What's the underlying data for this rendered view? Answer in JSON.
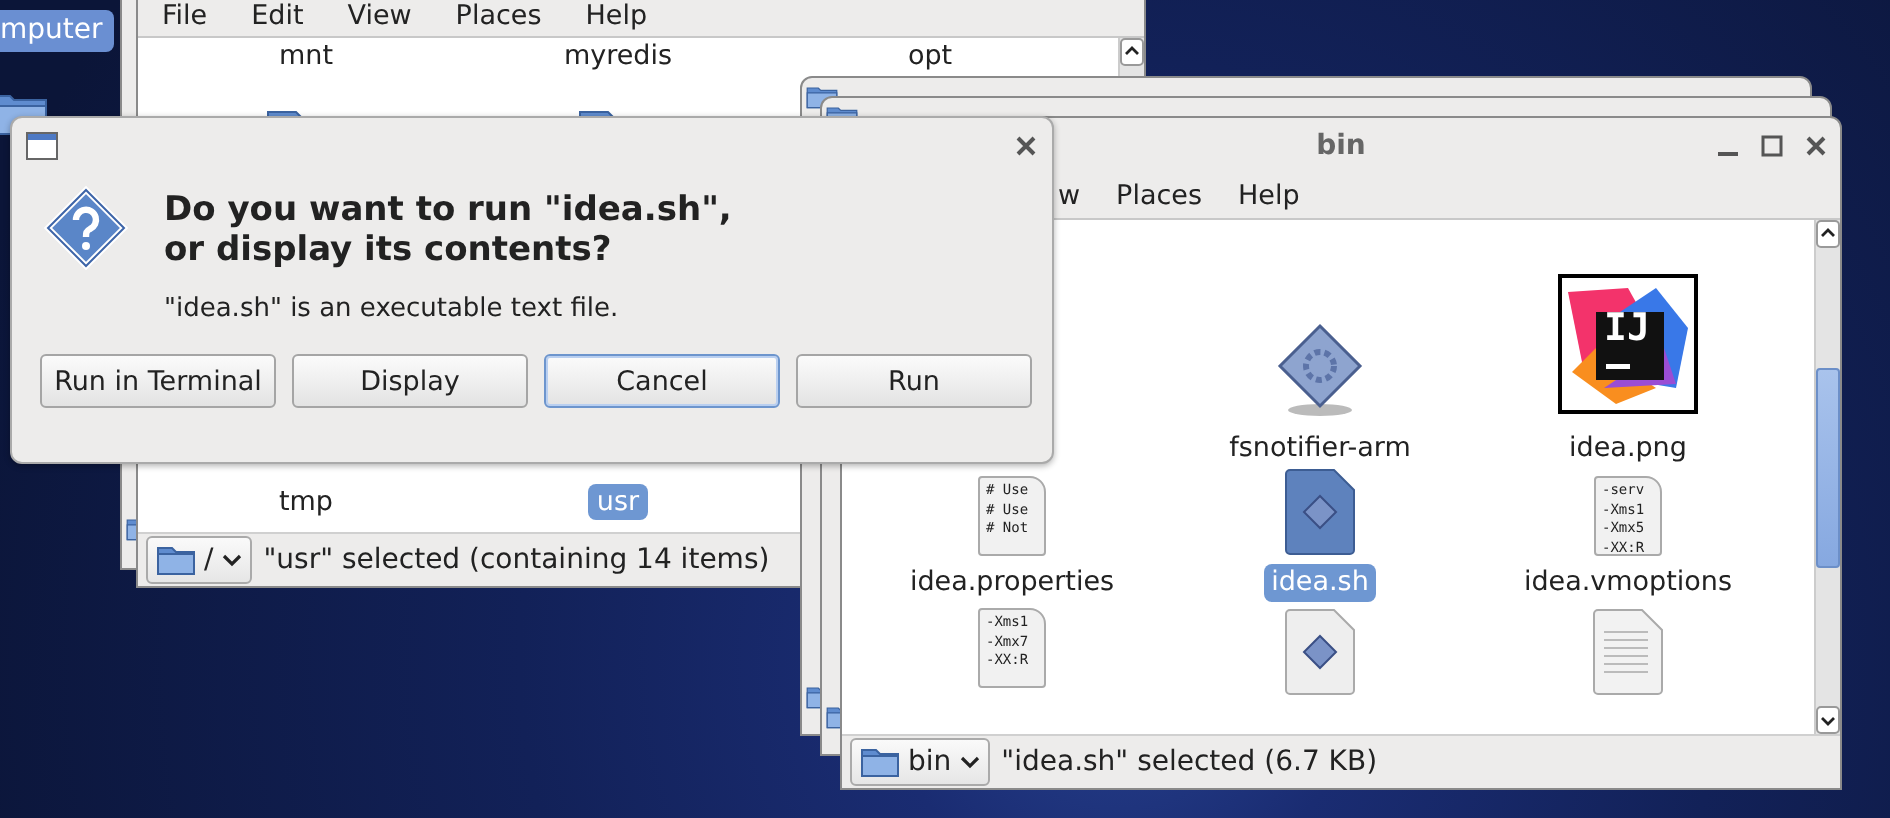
{
  "desktop": {
    "icons": [
      {
        "label": "mputer",
        "selected": true
      }
    ]
  },
  "root_window": {
    "menu": [
      "File",
      "Edit",
      "View",
      "Places",
      "Help"
    ],
    "top_labels": [
      "mnt",
      "myredis",
      "opt"
    ],
    "items": [
      {
        "label": "tmp",
        "selected": false
      },
      {
        "label": "usr",
        "selected": true
      }
    ],
    "location": "/",
    "status": "\"usr\" selected (containing 14 items)"
  },
  "bin_window": {
    "title": "bin",
    "menu": [
      "w",
      "Places",
      "Help"
    ],
    "items": [
      {
        "kind": "hidden"
      },
      {
        "kind": "executable",
        "label": "fsnotifier-arm",
        "selected": false
      },
      {
        "kind": "image",
        "label": "idea.png",
        "thumbnail_text": "IJ",
        "selected": false
      },
      {
        "kind": "text",
        "label": "idea.properties",
        "preview": [
          "# Use",
          "# Use",
          "# Not"
        ],
        "selected": false
      },
      {
        "kind": "script",
        "label": "idea.sh",
        "selected": true
      },
      {
        "kind": "text",
        "label": "idea.vmoptions",
        "preview": [
          "-serv",
          "-Xms1",
          "-Xmx5",
          "-XX:R"
        ],
        "selected": false
      },
      {
        "kind": "text",
        "preview": [
          "-Xms1",
          "-Xmx7",
          "-XX:R"
        ]
      },
      {
        "kind": "script"
      },
      {
        "kind": "document"
      }
    ],
    "location": "bin",
    "status": "\"idea.sh\" selected (6.7 KB)"
  },
  "dialog": {
    "heading": "Do you want to run \"idea.sh\",\nor display its contents?",
    "message": "\"idea.sh\" is an executable text file.",
    "buttons": [
      {
        "label": "Run in Terminal",
        "focused": false
      },
      {
        "label": "Display",
        "focused": false
      },
      {
        "label": "Cancel",
        "focused": true
      },
      {
        "label": "Run",
        "focused": false
      }
    ]
  }
}
